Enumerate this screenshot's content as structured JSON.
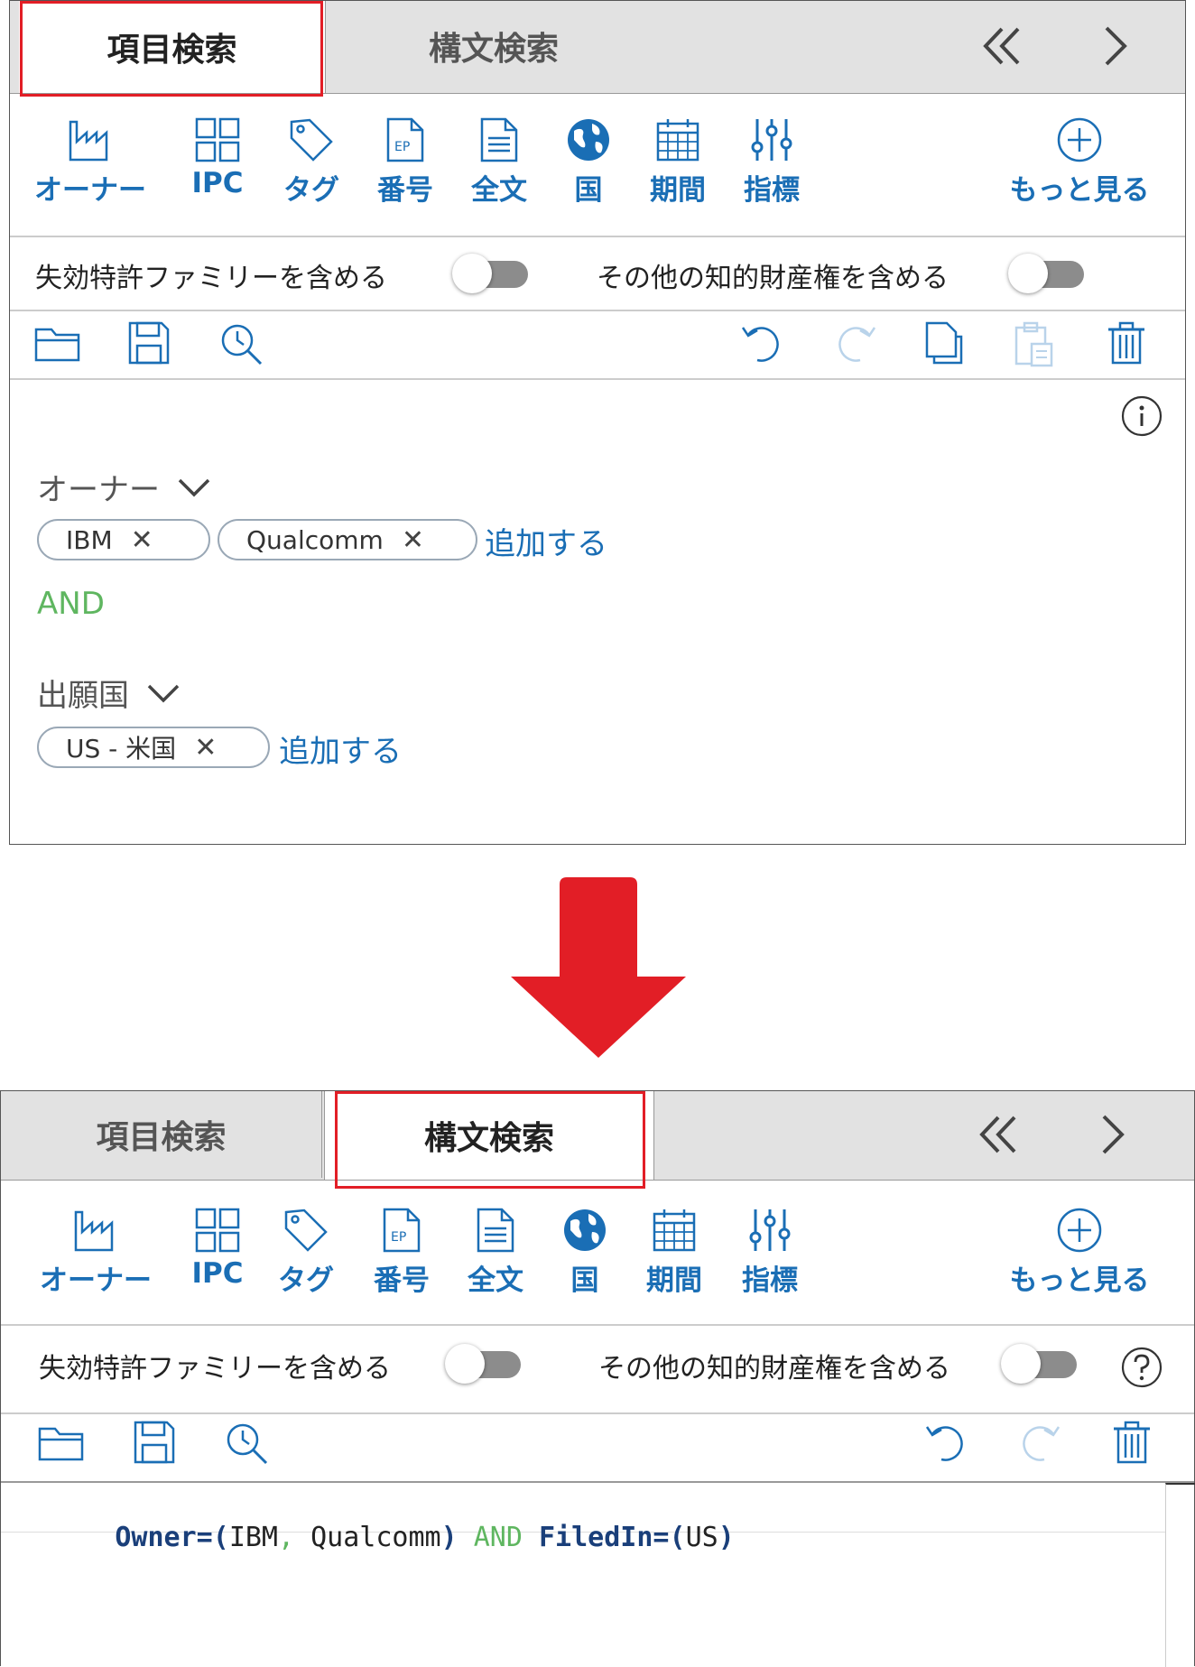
{
  "tabs": {
    "field_search": "項目検索",
    "syntax_search": "構文検索"
  },
  "nav": {
    "collapse_icon": "double-chevron-left-icon",
    "next_icon": "chevron-right-icon"
  },
  "toolbar": {
    "owner": "オーナー",
    "ipc": "IPC",
    "tag": "タグ",
    "number": "番号",
    "fulltext": "全文",
    "country": "国",
    "period": "期間",
    "indicator": "指標",
    "more": "もっと見る"
  },
  "options": {
    "include_lapsed": "失効特許ファミリーを含める",
    "include_other_ip": "その他の知的財産権を含める"
  },
  "editor": {
    "owner_group": "オーナー",
    "owner_chips": [
      "IBM",
      "Qualcomm"
    ],
    "add_label": "追加する",
    "and_label": "AND",
    "country_group": "出願国",
    "country_chips": [
      "US - 米国"
    ],
    "chip_remove": "✕"
  },
  "syntax": {
    "owner_key": "Owner=(",
    "owner_vals": "IBM",
    "comma": ",",
    "owner_val2": " Qualcomm",
    "close1": ")",
    "and_op": " AND ",
    "filed_key": "FiledIn=(",
    "filed_val": "US",
    "close2": ")"
  },
  "colors": {
    "accent": "#1a6eb5",
    "highlight": "#e21e26",
    "and_green": "#5fb660"
  }
}
